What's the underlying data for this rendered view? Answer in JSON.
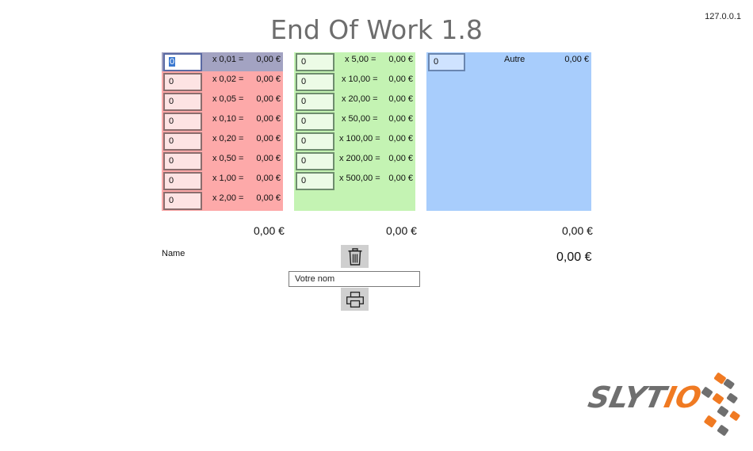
{
  "app": {
    "title": "End Of Work 1.8",
    "ip": "127.0.0.1"
  },
  "coins": {
    "rows": [
      {
        "qty": "0",
        "mult": "x 0,01 =",
        "result": "0,00 €"
      },
      {
        "qty": "0",
        "mult": "x 0,02 =",
        "result": "0,00 €"
      },
      {
        "qty": "0",
        "mult": "x 0,05 =",
        "result": "0,00 €"
      },
      {
        "qty": "0",
        "mult": "x 0,10 =",
        "result": "0,00 €"
      },
      {
        "qty": "0",
        "mult": "x 0,20 =",
        "result": "0,00 €"
      },
      {
        "qty": "0",
        "mult": "x 0,50 =",
        "result": "0,00 €"
      },
      {
        "qty": "0",
        "mult": "x 1,00 =",
        "result": "0,00 €"
      },
      {
        "qty": "0",
        "mult": "x 2,00 =",
        "result": "0,00 €"
      }
    ],
    "total": "0,00 €"
  },
  "notes": {
    "rows": [
      {
        "qty": "0",
        "mult": "x 5,00 =",
        "result": "0,00 €"
      },
      {
        "qty": "0",
        "mult": "x 10,00 =",
        "result": "0,00 €"
      },
      {
        "qty": "0",
        "mult": "x 20,00 =",
        "result": "0,00 €"
      },
      {
        "qty": "0",
        "mult": "x 50,00 =",
        "result": "0,00 €"
      },
      {
        "qty": "0",
        "mult": "x 100,00 =",
        "result": "0,00 €"
      },
      {
        "qty": "0",
        "mult": "x 200,00 =",
        "result": "0,00 €"
      },
      {
        "qty": "0",
        "mult": "x 500,00 =",
        "result": "0,00 €"
      }
    ],
    "total": "0,00 €"
  },
  "other": {
    "qty": "0",
    "label": "Autre",
    "result": "0,00 €",
    "total": "0,00 €"
  },
  "grand_total": "0,00 €",
  "form": {
    "name_label": "Name",
    "name_placeholder": "Votre nom"
  },
  "icons": {
    "delete": "trash-icon",
    "print": "printer-icon"
  },
  "logo": {
    "text": "SLYTIO"
  },
  "colors": {
    "coins_bg": "#fda9a9",
    "notes_bg": "#c4f3b3",
    "other_bg": "#a8cdfc",
    "logo_gray": "#6f6f6f",
    "logo_orange": "#f07a22"
  }
}
